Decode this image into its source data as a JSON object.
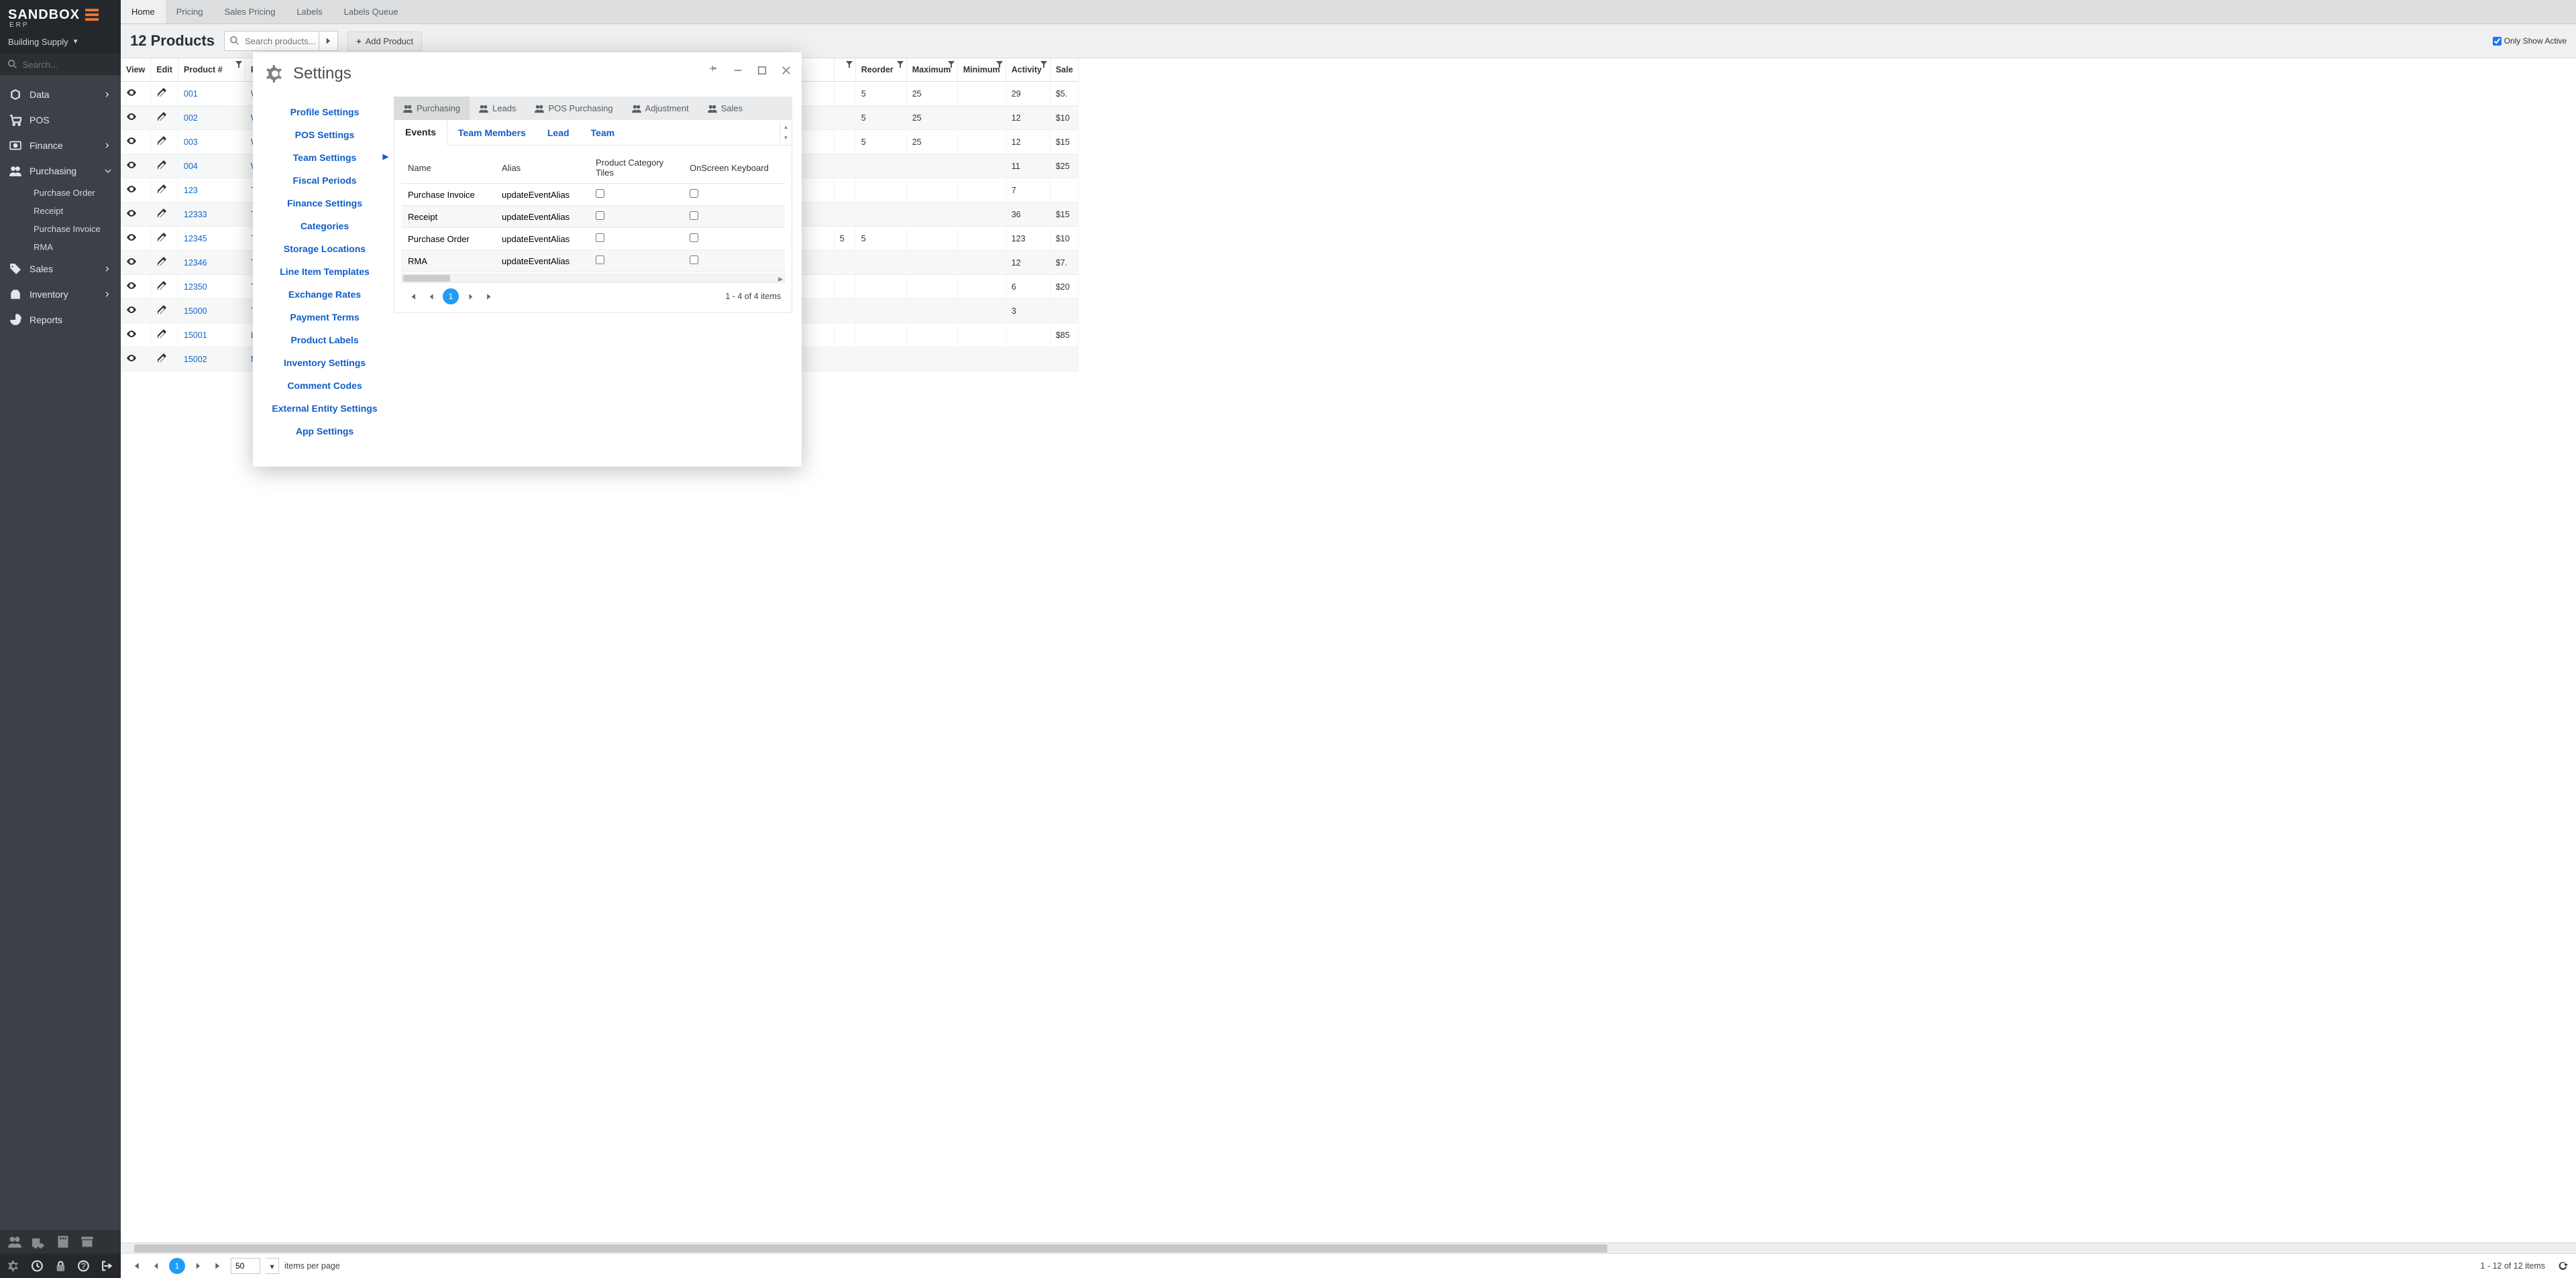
{
  "logo": {
    "word": "SANDBOX",
    "sub": "ERP"
  },
  "company": "Building Supply",
  "sidebar_search_placeholder": "Search...",
  "nav": {
    "data": "Data",
    "pos": "POS",
    "finance": "Finance",
    "purchasing": "Purchasing",
    "purchasing_children": [
      "Purchase Order",
      "Receipt",
      "Purchase Invoice",
      "RMA"
    ],
    "sales": "Sales",
    "inventory": "Inventory",
    "reports": "Reports"
  },
  "tabs": [
    "Home",
    "Pricing",
    "Sales Pricing",
    "Labels",
    "Labels Queue"
  ],
  "products_count": "12",
  "products_label": "Products",
  "search_products_placeholder": "Search products...",
  "add_product": "Add Product",
  "only_show_active": "Only Show Active",
  "grid_headers": {
    "view": "View",
    "edit": "Edit",
    "product_no": "Product #",
    "product": "Pro",
    "reorder": "Reorder",
    "maximum": "Maximum",
    "minimum": "Minimum",
    "activity": "Activity",
    "sale": "Sale",
    "gap": ""
  },
  "grid_rows": [
    {
      "pn": "001",
      "name": "Wi",
      "reorder": "5",
      "max": "25",
      "min": "",
      "act": "29",
      "sale": "$5."
    },
    {
      "pn": "002",
      "name": "Wi",
      "reorder": "5",
      "max": "25",
      "min": "",
      "act": "12",
      "sale": "$10"
    },
    {
      "pn": "003",
      "name": "Wi",
      "reorder": "5",
      "max": "25",
      "min": "",
      "act": "12",
      "sale": "$15"
    },
    {
      "pn": "004",
      "name": "Wi",
      "reorder": "",
      "max": "",
      "min": "",
      "act": "11",
      "sale": "$25"
    },
    {
      "pn": "123",
      "name": "Tes",
      "reorder": "",
      "max": "",
      "min": "",
      "act": "7",
      "sale": ""
    },
    {
      "pn": "12333",
      "name": "Tes",
      "reorder": "",
      "max": "",
      "min": "",
      "act": "36",
      "sale": "$15"
    },
    {
      "pn": "12345",
      "name": "Tes",
      "reorder": "5",
      "max": "",
      "min": "",
      "act": "123",
      "sale": "$10"
    },
    {
      "pn": "12346",
      "name": "Tes",
      "reorder": "",
      "max": "",
      "min": "",
      "act": "12",
      "sale": "$7."
    },
    {
      "pn": "12350",
      "name": "Tes",
      "reorder": "",
      "max": "",
      "min": "",
      "act": "6",
      "sale": "$20"
    },
    {
      "pn": "15000",
      "name": "Tin",
      "reorder": "",
      "max": "",
      "min": "",
      "act": "3",
      "sale": ""
    },
    {
      "pn": "15001",
      "name": "Lat",
      "reorder": "",
      "max": "",
      "min": "",
      "act": "",
      "sale": "$85"
    },
    {
      "pn": "15002",
      "name": "Ma",
      "reorder": "",
      "max": "",
      "min": "",
      "act": "",
      "sale": ""
    }
  ],
  "pager": {
    "page": "1",
    "size": "50",
    "size_label": "items per page",
    "info": "1 - 12 of 12 items"
  },
  "modal": {
    "title": "Settings",
    "nav": [
      "Profile Settings",
      "POS Settings",
      "Team Settings",
      "Fiscal Periods",
      "Finance Settings",
      "Categories",
      "Storage Locations",
      "Line Item Templates",
      "Exchange Rates",
      "Payment Terms",
      "Product Labels",
      "Inventory Settings",
      "Comment Codes",
      "External Entity Settings",
      "App Settings"
    ],
    "nav_selected_index": 2,
    "module_tabs": [
      "Purchasing",
      "Leads",
      "POS Purchasing",
      "Adjustment",
      "Sales"
    ],
    "sub_tabs": [
      "Events",
      "Team Members",
      "Lead",
      "Team"
    ],
    "events_headers": [
      "Name",
      "Alias",
      "Product Category Tiles",
      "OnScreen Keyboard"
    ],
    "events_rows": [
      {
        "name": "Purchase Invoice",
        "alias": "updateEventAlias"
      },
      {
        "name": "Receipt",
        "alias": "updateEventAlias"
      },
      {
        "name": "Purchase Order",
        "alias": "updateEventAlias"
      },
      {
        "name": "RMA",
        "alias": "updateEventAlias"
      }
    ],
    "events_pager": {
      "page": "1",
      "info": "1 - 4 of 4 items"
    }
  }
}
